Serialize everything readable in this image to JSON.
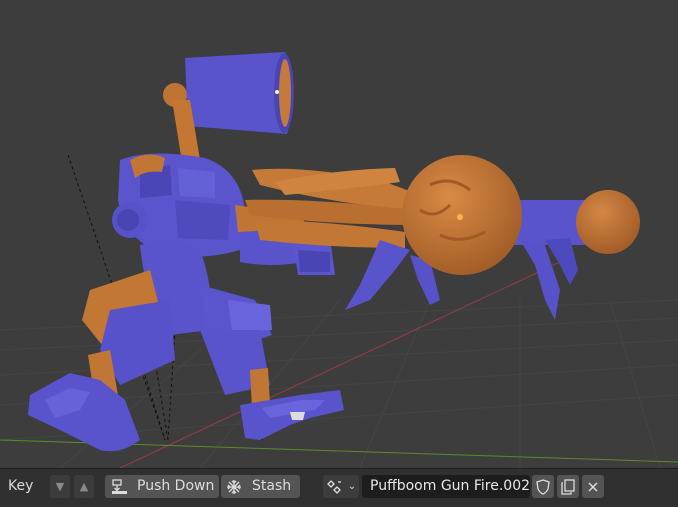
{
  "header": {
    "key_menu": "Key",
    "push_down_label": "Push Down",
    "stash_label": "Stash",
    "action_name": "Puffboom Gun Fire.002"
  },
  "icons": {
    "push_down": "push-down-icon",
    "stash": "snowflake-icon",
    "browse_action": "action-browse-icon",
    "fake_user": "shield-icon",
    "duplicate": "duplicate-icon",
    "unlink": "close-icon"
  },
  "colors": {
    "viewport_bg": "#3d3d3d",
    "header_bg": "#303030",
    "button_bg": "#545454",
    "field_bg": "#1d1d1d",
    "model_blue": "#5c57cf",
    "model_orange": "#c77b3b"
  }
}
